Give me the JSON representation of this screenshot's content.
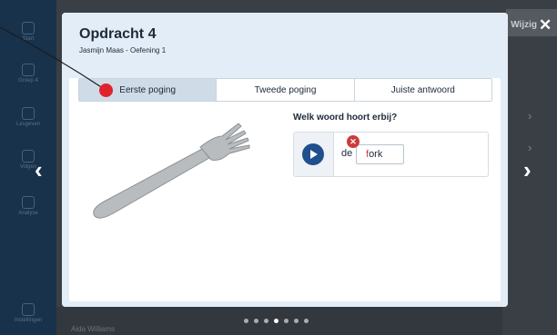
{
  "background": {
    "nav_items": [
      {
        "label": "Start",
        "icon": "home-icon"
      },
      {
        "label": "Groep 4",
        "icon": "group-icon"
      },
      {
        "label": "Lesgeven",
        "icon": "lesson-icon"
      },
      {
        "label": "Volgen",
        "icon": "follow-icon"
      },
      {
        "label": "Analyse",
        "icon": "analysis-icon"
      },
      {
        "label": "Instellingen",
        "icon": "settings-icon"
      }
    ],
    "top_right_text": "Wijzig",
    "bottom_text": "Aida Williams"
  },
  "modal": {
    "title": "Opdracht 4",
    "subtitle": "Jasmijn Maas - Oefening 1",
    "tabs": [
      {
        "label": "Eerste poging",
        "active": true
      },
      {
        "label": "Tweede poging",
        "active": false
      },
      {
        "label": "Juiste antwoord",
        "active": false
      }
    ],
    "question": "Welk woord hoort erbij?",
    "answer": {
      "article": "de",
      "word_first_letter": "f",
      "word_rest": "ork",
      "status_icon": "wrong-x-icon"
    },
    "image_icon": "fork-icon"
  },
  "navigation": {
    "prev_arrow": "‹",
    "next_arrow": "›",
    "close": "✕",
    "page_count": 7,
    "active_page": 4
  },
  "colors": {
    "accent": "#1f4f8c",
    "error": "#cf3a3a",
    "marker": "#e0222b",
    "header_bg": "#e2edf7"
  }
}
